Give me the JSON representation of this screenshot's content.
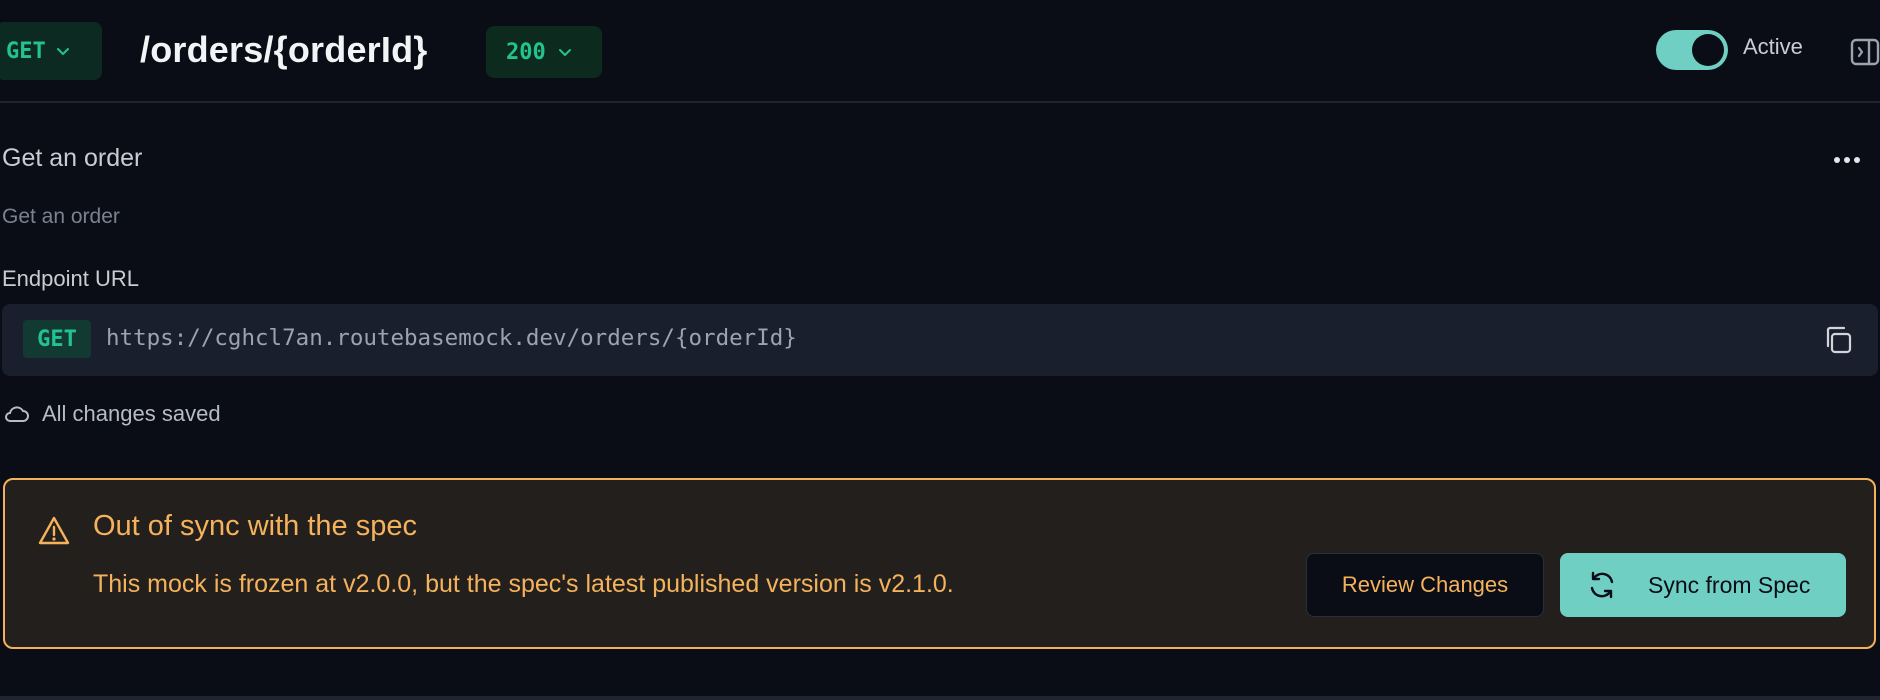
{
  "header": {
    "method": "GET",
    "path": "/orders/{orderId}",
    "status_code": "200",
    "active_label": "Active",
    "active": true
  },
  "main": {
    "summary": "Get an order",
    "description": "Get an order",
    "endpoint_label": "Endpoint URL",
    "endpoint_method": "GET",
    "endpoint_url": "https://cghcl7an.routebasemock.dev/orders/{orderId}",
    "save_status": "All changes saved"
  },
  "warning": {
    "title": "Out of sync with the spec",
    "message": "This mock is frozen at v2.0.0, but the spec's latest published version is v2.1.0.",
    "review_label": "Review Changes",
    "sync_label": "Sync from Spec"
  },
  "icons": {
    "method_dropdown": "chevron-down-icon",
    "status_dropdown": "chevron-down-icon",
    "panel": "panel-right-icon",
    "more": "more-horizontal-icon",
    "copy": "copy-icon",
    "saved": "cloud-icon",
    "warning": "alert-triangle-icon",
    "sync": "refresh-icon"
  },
  "colors": {
    "background": "#0a0d16",
    "method_green": "#22c38e",
    "accent_teal": "#6fcfc3",
    "warning_amber": "#f4b25c"
  }
}
